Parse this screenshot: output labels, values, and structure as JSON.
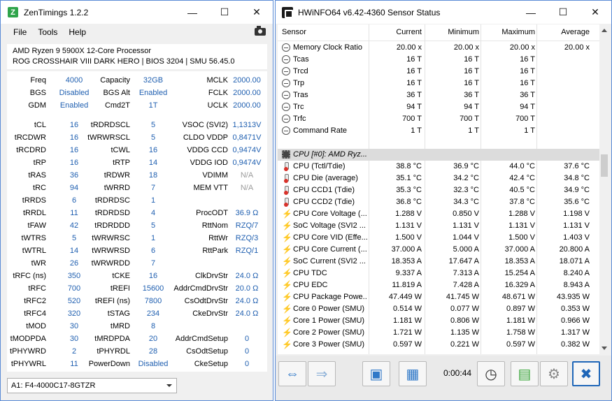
{
  "zentimings": {
    "title": "ZenTimings 1.2.2",
    "icon_letter": "Z",
    "menu": [
      "File",
      "Tools",
      "Help"
    ],
    "cpu": "AMD Ryzen 9 5900X 12-Core Processor",
    "board": "ROG CROSSHAIR VIII DARK HERO | BIOS 3204 | SMU 56.45.0",
    "rows": [
      [
        "Freq",
        "4000",
        "Capacity",
        "32GB",
        "MCLK",
        "2000.00"
      ],
      [
        "BGS",
        "Disabled",
        "BGS Alt",
        "Enabled",
        "FCLK",
        "2000.00"
      ],
      [
        "GDM",
        "Enabled",
        "Cmd2T",
        "1T",
        "UCLK",
        "2000.00"
      ],
      [
        "tCL",
        "16",
        "tRDRDSCL",
        "5",
        "VSOC (SVI2)",
        "1,1313V"
      ],
      [
        "tRCDWR",
        "16",
        "tWRWRSCL",
        "5",
        "CLDO VDDP",
        "0,8471V"
      ],
      [
        "tRCDRD",
        "16",
        "tCWL",
        "16",
        "VDDG CCD",
        "0,9474V"
      ],
      [
        "tRP",
        "16",
        "tRTP",
        "14",
        "VDDG IOD",
        "0,9474V"
      ],
      [
        "tRAS",
        "36",
        "tRDWR",
        "18",
        "VDIMM",
        "N/A"
      ],
      [
        "tRC",
        "94",
        "tWRRD",
        "7",
        "MEM VTT",
        "N/A"
      ],
      [
        "tRRDS",
        "6",
        "tRDRDSC",
        "1",
        "",
        ""
      ],
      [
        "tRRDL",
        "11",
        "tRDRDSD",
        "4",
        "ProcODT",
        "36.9 Ω"
      ],
      [
        "tFAW",
        "42",
        "tRDRDDD",
        "5",
        "RttNom",
        "RZQ/7"
      ],
      [
        "tWTRS",
        "5",
        "tWRWRSC",
        "1",
        "RttWr",
        "RZQ/3"
      ],
      [
        "tWTRL",
        "14",
        "tWRWRSD",
        "6",
        "RttPark",
        "RZQ/1"
      ],
      [
        "tWR",
        "26",
        "tWRWRDD",
        "7",
        "",
        ""
      ],
      [
        "tRFC (ns)",
        "350",
        "tCKE",
        "16",
        "ClkDrvStr",
        "24.0 Ω"
      ],
      [
        "tRFC",
        "700",
        "tREFI",
        "15600",
        "AddrCmdDrvStr",
        "20.0 Ω"
      ],
      [
        "tRFC2",
        "520",
        "tREFI (ns)",
        "7800",
        "CsOdtDrvStr",
        "24.0 Ω"
      ],
      [
        "tRFC4",
        "320",
        "tSTAG",
        "234",
        "CkeDrvStr",
        "24.0 Ω"
      ],
      [
        "tMOD",
        "30",
        "tMRD",
        "8",
        "",
        ""
      ],
      [
        "tMODPDA",
        "30",
        "tMRDPDA",
        "20",
        "AddrCmdSetup",
        "0"
      ],
      [
        "tPHYWRD",
        "2",
        "tPHYRDL",
        "28",
        "CsOdtSetup",
        "0"
      ],
      [
        "tPHYWRL",
        "11",
        "PowerDown",
        "Disabled",
        "CkeSetup",
        "0"
      ]
    ],
    "gray_values": [
      "N/A"
    ],
    "profile": "A1: F4-4000C17-8GTZR"
  },
  "hwinfo": {
    "title": "HWiNFO64 v6.42-4360 Sensor Status",
    "columns": [
      "Sensor",
      "Current",
      "Minimum",
      "Maximum",
      "Average"
    ],
    "rows": [
      {
        "icon": "clock",
        "name": "Memory Clock Ratio",
        "cur": "20.00 x",
        "min": "20.00 x",
        "max": "20.00 x",
        "avg": "20.00 x"
      },
      {
        "icon": "clock",
        "name": "Tcas",
        "cur": "16 T",
        "min": "16 T",
        "max": "16 T",
        "avg": ""
      },
      {
        "icon": "clock",
        "name": "Trcd",
        "cur": "16 T",
        "min": "16 T",
        "max": "16 T",
        "avg": ""
      },
      {
        "icon": "clock",
        "name": "Trp",
        "cur": "16 T",
        "min": "16 T",
        "max": "16 T",
        "avg": ""
      },
      {
        "icon": "clock",
        "name": "Tras",
        "cur": "36 T",
        "min": "36 T",
        "max": "36 T",
        "avg": ""
      },
      {
        "icon": "clock",
        "name": "Trc",
        "cur": "94 T",
        "min": "94 T",
        "max": "94 T",
        "avg": ""
      },
      {
        "icon": "clock",
        "name": "Trfc",
        "cur": "700 T",
        "min": "700 T",
        "max": "700 T",
        "avg": ""
      },
      {
        "icon": "clock",
        "name": "Command Rate",
        "cur": "1 T",
        "min": "1 T",
        "max": "1 T",
        "avg": ""
      },
      {
        "icon": "",
        "name": "",
        "cur": "",
        "min": "",
        "max": "",
        "avg": ""
      },
      {
        "icon": "chip",
        "name": "CPU [#0]: AMD Ryz...",
        "cur": "",
        "min": "",
        "max": "",
        "avg": "",
        "section": true
      },
      {
        "icon": "therm",
        "name": "CPU (Tctl/Tdie)",
        "cur": "38.8 °C",
        "min": "36.9 °C",
        "max": "44.0 °C",
        "avg": "37.6 °C"
      },
      {
        "icon": "therm",
        "name": "CPU Die (average)",
        "cur": "35.1 °C",
        "min": "34.2 °C",
        "max": "42.4 °C",
        "avg": "34.8 °C"
      },
      {
        "icon": "therm",
        "name": "CPU CCD1 (Tdie)",
        "cur": "35.3 °C",
        "min": "32.3 °C",
        "max": "40.5 °C",
        "avg": "34.9 °C"
      },
      {
        "icon": "therm",
        "name": "CPU CCD2 (Tdie)",
        "cur": "36.8 °C",
        "min": "34.3 °C",
        "max": "37.8 °C",
        "avg": "35.6 °C"
      },
      {
        "icon": "bolt",
        "name": "CPU Core Voltage (...",
        "cur": "1.288 V",
        "min": "0.850 V",
        "max": "1.288 V",
        "avg": "1.198 V"
      },
      {
        "icon": "bolt",
        "name": "SoC Voltage (SVI2 ...",
        "cur": "1.131 V",
        "min": "1.131 V",
        "max": "1.131 V",
        "avg": "1.131 V"
      },
      {
        "icon": "bolt",
        "name": "CPU Core VID (Effe...",
        "cur": "1.500 V",
        "min": "1.044 V",
        "max": "1.500 V",
        "avg": "1.403 V"
      },
      {
        "icon": "bolt",
        "name": "CPU Core Current (...",
        "cur": "37.000 A",
        "min": "5.000 A",
        "max": "37.000 A",
        "avg": "20.800 A"
      },
      {
        "icon": "bolt",
        "name": "SoC Current (SVI2 ...",
        "cur": "18.353 A",
        "min": "17.647 A",
        "max": "18.353 A",
        "avg": "18.071 A"
      },
      {
        "icon": "bolt",
        "name": "CPU TDC",
        "cur": "9.337 A",
        "min": "7.313 A",
        "max": "15.254 A",
        "avg": "8.240 A"
      },
      {
        "icon": "bolt",
        "name": "CPU EDC",
        "cur": "11.819 A",
        "min": "7.428 A",
        "max": "16.329 A",
        "avg": "8.943 A"
      },
      {
        "icon": "bolt",
        "name": "CPU Package Powe...",
        "cur": "47.449 W",
        "min": "41.745 W",
        "max": "48.671 W",
        "avg": "43.935 W"
      },
      {
        "icon": "bolt",
        "name": "Core 0 Power (SMU)",
        "cur": "0.514 W",
        "min": "0.077 W",
        "max": "0.897 W",
        "avg": "0.353 W"
      },
      {
        "icon": "bolt",
        "name": "Core 1 Power (SMU)",
        "cur": "1.181 W",
        "min": "0.806 W",
        "max": "1.181 W",
        "avg": "0.966 W"
      },
      {
        "icon": "bolt",
        "name": "Core 2 Power (SMU)",
        "cur": "1.721 W",
        "min": "1.135 W",
        "max": "1.758 W",
        "avg": "1.317 W"
      },
      {
        "icon": "bolt",
        "name": "Core 3 Power (SMU)",
        "cur": "0.597 W",
        "min": "0.221 W",
        "max": "0.597 W",
        "avg": "0.382 W"
      }
    ],
    "timer": "0:00:44",
    "toolbar_icons": [
      "expand-arrows-icon",
      "collapse-arrows-icon",
      "monitor-icon",
      "network-icon",
      "clock-icon",
      "report-icon",
      "settings-icon",
      "close-icon"
    ]
  }
}
